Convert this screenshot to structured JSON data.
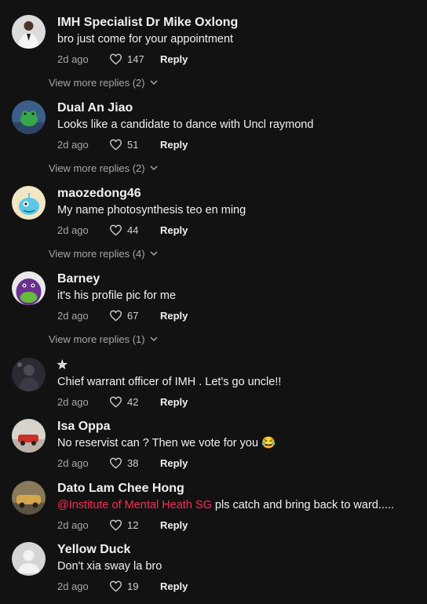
{
  "comments": [
    {
      "name": "IMH Specialist Dr Mike Oxlong",
      "text": "bro just come for your appointment",
      "time": "2d ago",
      "likes": "147",
      "reply": "Reply",
      "view_more": "View more replies (2)",
      "avatar": "person-suit-avatar"
    },
    {
      "name": "Dual An Jiao",
      "text": "Looks like a candidate to dance with Uncl raymond",
      "time": "2d ago",
      "likes": "51",
      "reply": "Reply",
      "view_more": "View more replies (2)",
      "avatar": "frog-avatar"
    },
    {
      "name": "maozedong46",
      "text": "My name photosynthesis teo en ming",
      "time": "2d ago",
      "likes": "44",
      "reply": "Reply",
      "view_more": "View more replies (4)",
      "avatar": "blue-creature-avatar"
    },
    {
      "name": "Barney",
      "text": "it's his profile pic for me",
      "time": "2d ago",
      "likes": "67",
      "reply": "Reply",
      "view_more": "View more replies (1)",
      "avatar": "barney-avatar"
    },
    {
      "name": "✮",
      "text": "Chief warrant officer of IMH . Let's go uncle!!",
      "time": "2d ago",
      "likes": "42",
      "reply": "Reply",
      "avatar": "dark-portrait-avatar"
    },
    {
      "name": "Isa Oppa",
      "text": "No reservist can ? Then we vote for you 😂",
      "time": "2d ago",
      "likes": "38",
      "reply": "Reply",
      "avatar": "red-car-avatar"
    },
    {
      "name": "Dato Lam Chee Hong",
      "mention": "@Institute of Mental Heath SG",
      "text": " pls catch and bring back to ward.....",
      "time": "2d ago",
      "likes": "12",
      "reply": "Reply",
      "avatar": "gold-car-avatar"
    },
    {
      "name": "Yellow Duck",
      "text": "Don't xia sway la bro",
      "time": "2d ago",
      "likes": "19",
      "reply": "Reply",
      "avatar": "default-user-avatar"
    }
  ],
  "colors": {
    "background": "#121212",
    "mention": "#fe2c55",
    "muted": "#a7a7a7"
  }
}
